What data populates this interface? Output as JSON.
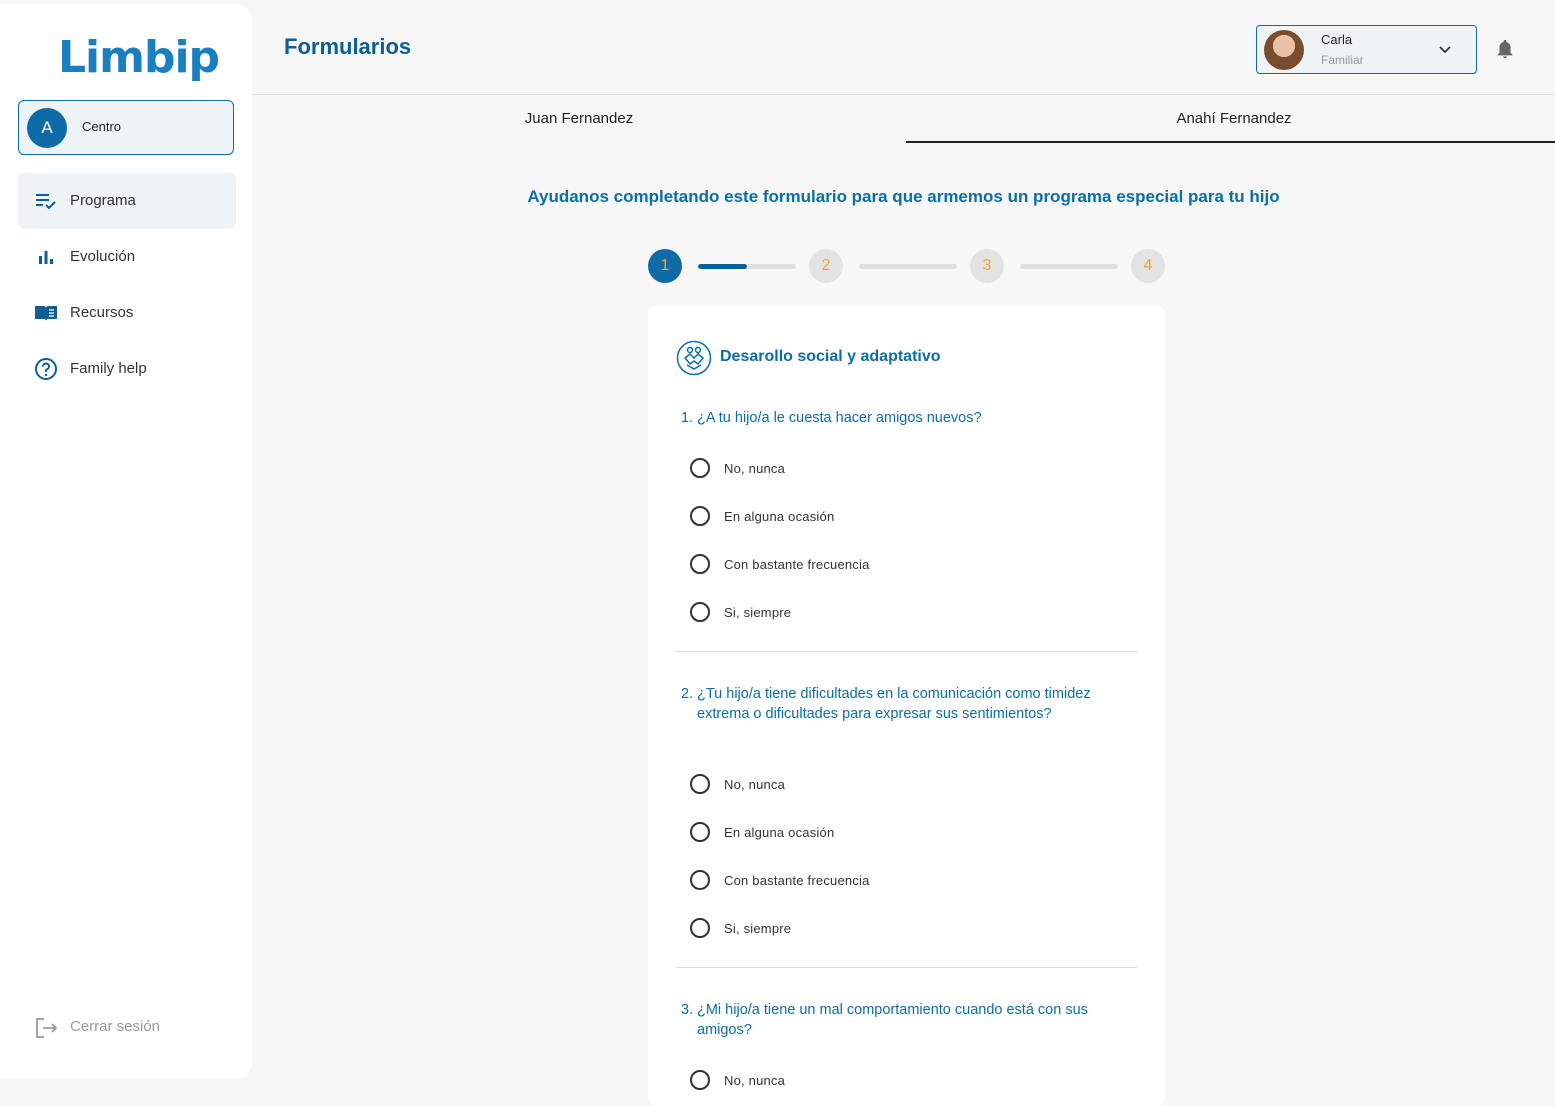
{
  "sidebar": {
    "logo": "Limbip",
    "center": {
      "initial": "A",
      "label": "Centro"
    },
    "items": [
      {
        "label": "Programa",
        "icon": "checklist-icon",
        "active": true
      },
      {
        "label": "Evolución",
        "icon": "bar-chart-icon",
        "active": false
      },
      {
        "label": "Recursos",
        "icon": "book-icon",
        "active": false
      },
      {
        "label": "Family help",
        "icon": "help-circle-icon",
        "active": false
      }
    ],
    "logout": {
      "label": "Cerrar sesión",
      "icon": "logout-icon"
    }
  },
  "header": {
    "title": "Formularios",
    "user": {
      "name": "Carla",
      "role": "Familiar"
    }
  },
  "tabs": [
    {
      "label": "Juan Fernandez",
      "selected": false
    },
    {
      "label": "Anahí Fernandez",
      "selected": true
    }
  ],
  "subtitle": "Ayudanos completando este formulario para que armemos un programa especial para tu hijo",
  "stepper": {
    "steps": [
      "1",
      "2",
      "3",
      "4"
    ],
    "current_step": 1,
    "progress": [
      0.5,
      0,
      0
    ]
  },
  "form": {
    "section_title": "Desarollo social y adaptativo",
    "questions": [
      {
        "number": "1.",
        "text": "¿A tu hijo/a le cuesta hacer amigos nuevos?",
        "options": [
          "No, nunca",
          "En alguna ocasión",
          "Con bastante frecuencia",
          "Si, siempre"
        ]
      },
      {
        "number": "2.",
        "text": "¿Tu hijo/a tiene dificultades en la comunicación como timidez extrema o dificultades para expresar sus sentimientos?",
        "options": [
          "No, nunca",
          "En alguna ocasión",
          "Con bastante frecuencia",
          "Si, siempre"
        ]
      },
      {
        "number": "3.",
        "text": "¿Mi hijo/a tiene un mal comportamiento cuando está con sus amigos?",
        "options": [
          "No, nunca"
        ]
      }
    ]
  },
  "colors": {
    "primary": "#0e6ba8",
    "accent": "#f5a623",
    "text_blue": "#0b6ea5"
  }
}
